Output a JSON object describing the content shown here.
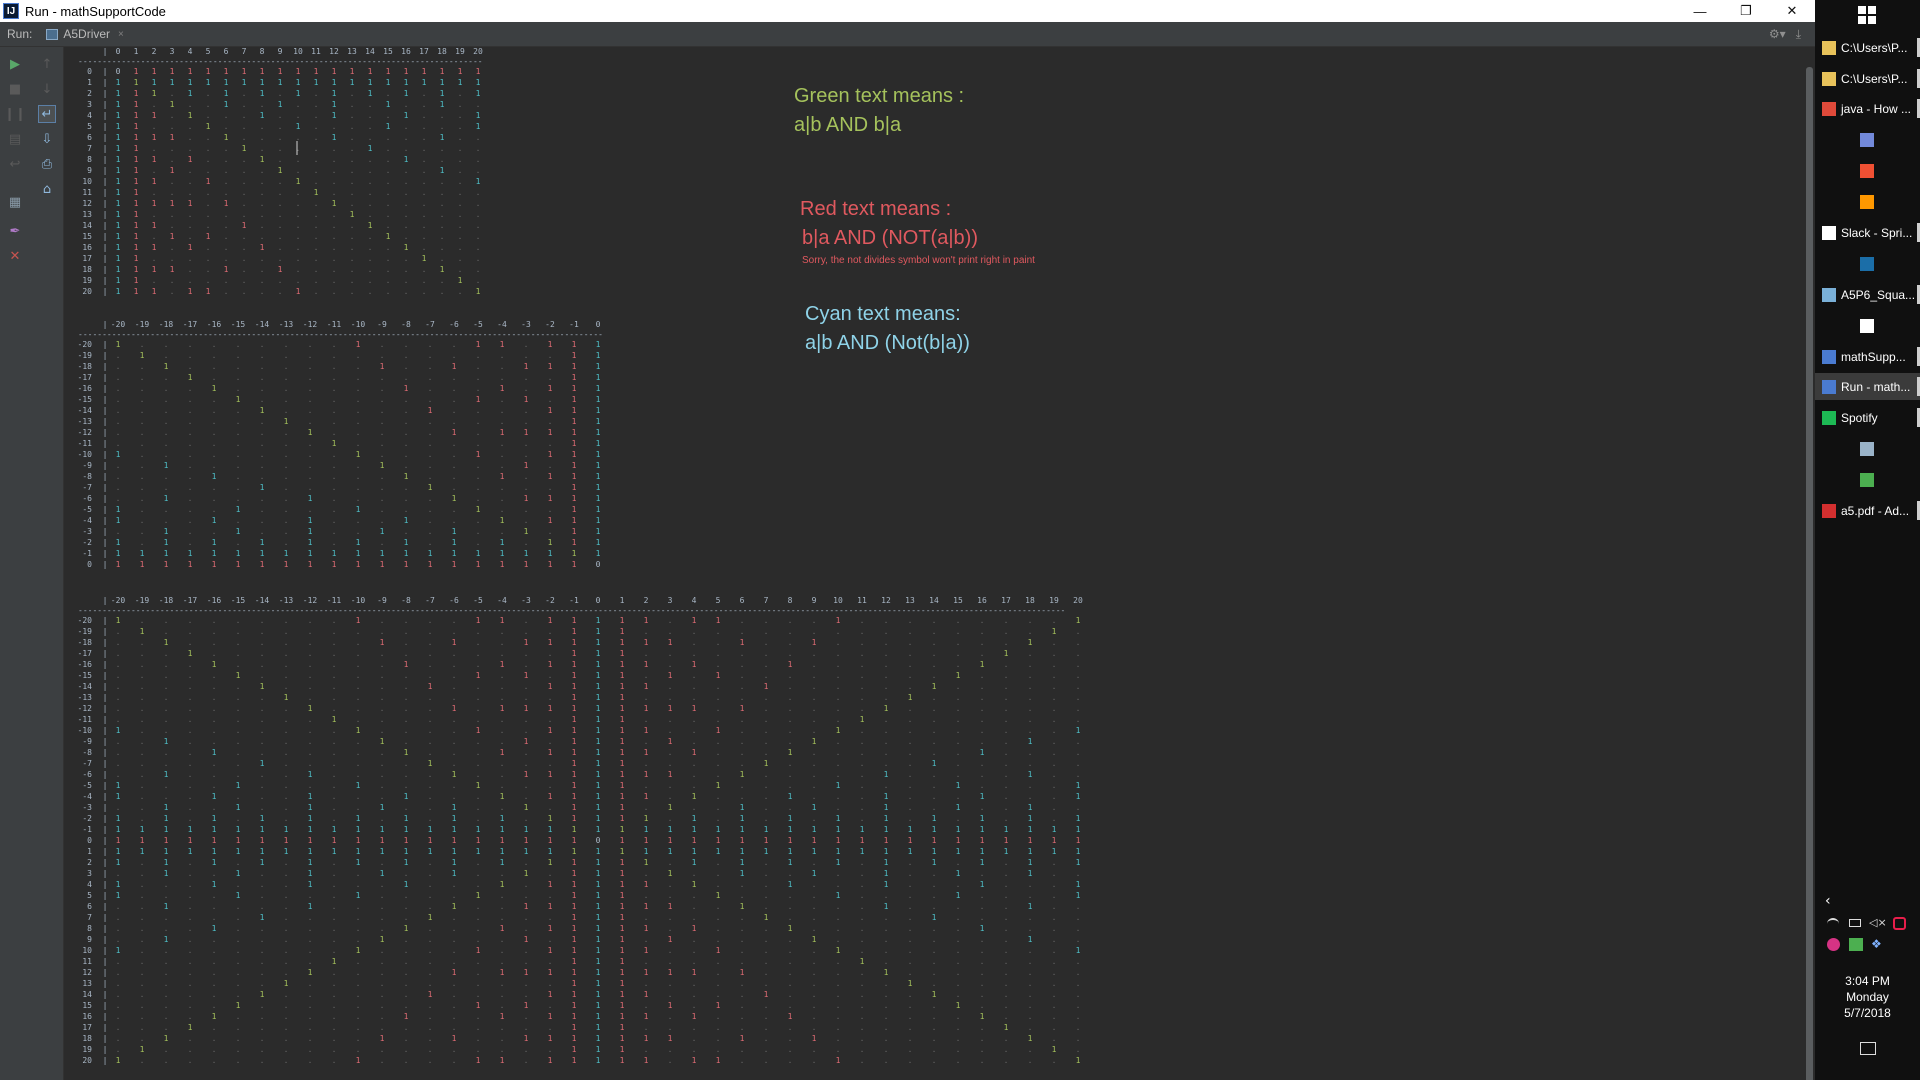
{
  "window": {
    "title": "Run - mathSupportCode",
    "app_icon": "intellij-icon"
  },
  "window_controls": {
    "minimize": "—",
    "restore": "❐",
    "close": "✕"
  },
  "run_bar": {
    "label": "Run:",
    "tab_label": "A5Driver",
    "tab_close": "×"
  },
  "left_toolbar": [
    {
      "name": "rerun-icon",
      "glyph": "▶",
      "color": "#59a869"
    },
    {
      "name": "stop-icon",
      "glyph": "■",
      "color": "#5a5a5a"
    },
    {
      "name": "pause-icon",
      "glyph": "❙❙",
      "color": "#5a5a5a"
    },
    {
      "name": "dump-threads-icon",
      "glyph": "▤",
      "color": "#5a5a5a"
    },
    {
      "name": "exit-icon",
      "glyph": "↩",
      "color": "#5a5a5a"
    },
    {
      "name": "layout-icon",
      "glyph": "▦",
      "color": "#8a9ba8"
    },
    {
      "name": "pin-icon",
      "glyph": "✒",
      "color": "#b07ac8"
    },
    {
      "name": "close-run-icon",
      "glyph": "✕",
      "color": "#c75450"
    },
    {
      "name": "up-icon",
      "glyph": "↑",
      "color": "#5a5a5a"
    },
    {
      "name": "down-icon",
      "glyph": "↓",
      "color": "#5a5a5a"
    },
    {
      "name": "soft-wrap-icon",
      "glyph": "↵",
      "color": "#8fb8dc"
    },
    {
      "name": "scroll-to-end-icon",
      "glyph": "⇩",
      "color": "#8fb8dc"
    },
    {
      "name": "print-icon",
      "glyph": "⎙",
      "color": "#8fb8dc"
    },
    {
      "name": "clear-all-icon",
      "glyph": "⌂",
      "color": "#8fb8dc"
    }
  ],
  "colors": {
    "green": "#a5c25c",
    "red": "#e06c75",
    "cyan": "#4fc1c9",
    "plain": "#a9b7c6",
    "dot": "#6a6a6a"
  },
  "legend": {
    "green_title": "Green text means :",
    "green_rule": "a|b AND b|a",
    "red_title": "Red text means :",
    "red_rule": "b|a AND (NOT(a|b))",
    "red_note": "Sorry, the not divides symbol won't print right in paint",
    "cyan_title": "Cyan text means:",
    "cyan_rule": "a|b AND (Not(b|a))"
  },
  "console": {
    "one": "1",
    "zero": "0",
    "dot": ".",
    "dash": "-",
    "pipe": "|",
    "grid1_range": [
      0,
      20
    ],
    "grid2_range": [
      -20,
      0
    ],
    "grid3_range": [
      -20,
      20
    ]
  },
  "taskbar": {
    "items": [
      {
        "label": "C:\\Users\\P...",
        "icon": "folder-icon",
        "color": "#e8c25a"
      },
      {
        "label": "C:\\Users\\P...",
        "icon": "folder-icon",
        "color": "#e8c25a"
      },
      {
        "label": "java - How ...",
        "icon": "chrome-icon",
        "color": "#e04a3a"
      },
      {
        "label": "",
        "icon": "discord-icon",
        "color": "#7289da"
      },
      {
        "label": "",
        "icon": "git-icon",
        "color": "#f05033"
      },
      {
        "label": "",
        "icon": "sublime-icon",
        "color": "#ff9800"
      },
      {
        "label": "Slack - Spri...",
        "icon": "slack-icon",
        "color": "#ffffff"
      },
      {
        "label": "",
        "icon": "steam-icon",
        "color": "#1b6ea8"
      },
      {
        "label": "A5P6_Squa...",
        "icon": "app-icon",
        "color": "#7ab0d8"
      },
      {
        "label": "",
        "icon": "document-icon",
        "color": "#ffffff"
      },
      {
        "label": "mathSupp...",
        "icon": "intellij-icon",
        "color": "#4a7bd1"
      },
      {
        "label": "Run - math...",
        "icon": "intellij-icon",
        "color": "#4a7bd1"
      },
      {
        "label": "Spotify",
        "icon": "spotify-icon",
        "color": "#1db954"
      },
      {
        "label": "",
        "icon": "monitor-icon",
        "color": "#9ab3c8"
      },
      {
        "label": "",
        "icon": "image-icon",
        "color": "#4caf50"
      },
      {
        "label": "a5.pdf - Ad...",
        "icon": "pdf-icon",
        "color": "#d32f2f"
      }
    ],
    "clock": {
      "time": "3:04 PM",
      "day": "Monday",
      "date": "5/7/2018"
    }
  }
}
